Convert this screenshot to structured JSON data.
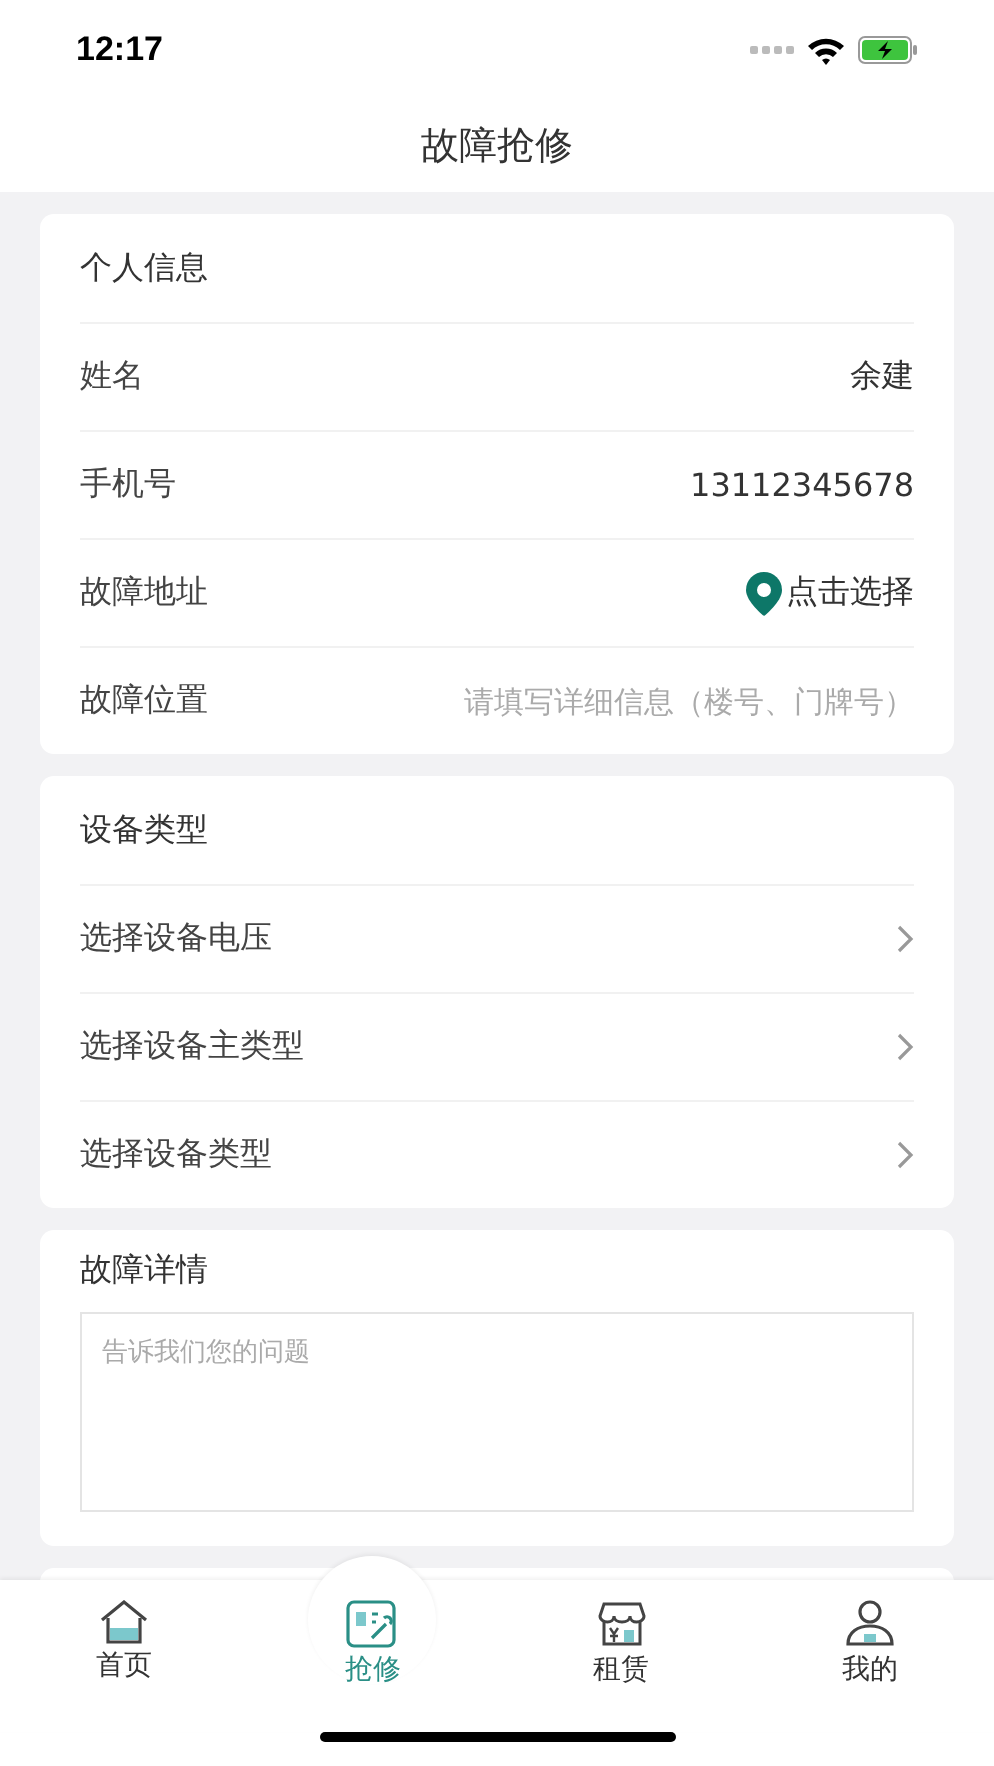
{
  "status_bar": {
    "time": "12:17"
  },
  "header": {
    "title": "故障抢修"
  },
  "personal_info": {
    "title": "个人信息",
    "rows": [
      {
        "kind": "value",
        "label": "姓名",
        "value": "余建"
      },
      {
        "kind": "value",
        "label": "手机号",
        "value": "13112345678"
      },
      {
        "kind": "location",
        "label": "故障地址",
        "value": "点击选择"
      },
      {
        "kind": "input",
        "label": "故障位置",
        "placeholder": "请填写详细信息（楼号、门牌号）"
      }
    ]
  },
  "device_type": {
    "title": "设备类型",
    "rows": [
      {
        "label": "选择设备电压"
      },
      {
        "label": "选择设备主类型"
      },
      {
        "label": "选择设备类型"
      }
    ]
  },
  "fault_details": {
    "title": "故障详情",
    "placeholder": "告诉我们您的问题"
  },
  "tabs": [
    {
      "kind": "home",
      "label": "首页",
      "selected": false
    },
    {
      "kind": "repair",
      "label": "抢修",
      "selected": true
    },
    {
      "kind": "rent",
      "label": "租赁",
      "selected": false
    },
    {
      "kind": "me",
      "label": "我的",
      "selected": false
    }
  ]
}
